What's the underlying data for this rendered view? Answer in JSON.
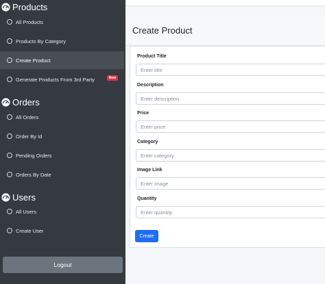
{
  "sidebar": {
    "sections": [
      {
        "title": "Products",
        "items": [
          {
            "label": "All Products"
          },
          {
            "label": "Products By Category"
          },
          {
            "label": "Create Product",
            "active": true
          },
          {
            "label": "Generate Products From 3rd Party",
            "badge": "New"
          }
        ]
      },
      {
        "title": "Orders",
        "items": [
          {
            "label": "All Orders"
          },
          {
            "label": "Order By Id"
          },
          {
            "label": "Pending Orders"
          },
          {
            "label": "Orders By Date"
          }
        ]
      },
      {
        "title": "Users",
        "items": [
          {
            "label": "All Users"
          },
          {
            "label": "Create User"
          }
        ]
      }
    ],
    "logout_label": "Logout"
  },
  "main": {
    "title": "Create Product",
    "form": {
      "fields": [
        {
          "label": "Product Title",
          "placeholder": "Enter title"
        },
        {
          "label": "Description",
          "placeholder": "Enter description"
        },
        {
          "label": "Price",
          "placeholder": "Enter price"
        },
        {
          "label": "Category",
          "placeholder": "Enter category"
        },
        {
          "label": "Image Link",
          "placeholder": "Enter image"
        },
        {
          "label": "Quantity",
          "placeholder": "Enter quantity"
        }
      ],
      "submit_label": "Create"
    }
  },
  "colors": {
    "sidebar_bg": "#343a40",
    "active_item_bg": "#494e53",
    "primary": "#1e6ef5",
    "badge": "#dc3545",
    "logout_bg": "#6c757d"
  }
}
